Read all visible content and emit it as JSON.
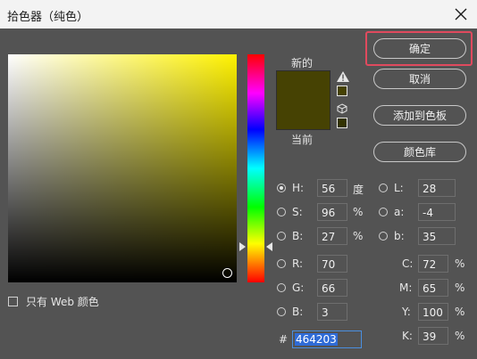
{
  "window": {
    "title": "拾色器（纯色）"
  },
  "preview": {
    "new_label": "新的",
    "current_label": "当前",
    "color": "#464203",
    "gamut_swatch": "#464203",
    "websafe_swatch": "#333300"
  },
  "buttons": {
    "ok": "确定",
    "cancel": "取消",
    "add_swatch": "添加到色板",
    "libraries": "颜色库"
  },
  "hsb": {
    "h_label": "H:",
    "h_value": "56",
    "h_unit": "度",
    "s_label": "S:",
    "s_value": "96",
    "s_unit": "%",
    "b_label": "B:",
    "b_value": "27",
    "b_unit": "%"
  },
  "lab": {
    "l_label": "L:",
    "l_value": "28",
    "a_label": "a:",
    "a_value": "-4",
    "b_label": "b:",
    "b_value": "35"
  },
  "rgb": {
    "r_label": "R:",
    "r_value": "70",
    "g_label": "G:",
    "g_value": "66",
    "b_label": "B:",
    "b_value": "3"
  },
  "cmyk": {
    "c_label": "C:",
    "c_value": "72",
    "c_unit": "%",
    "m_label": "M:",
    "m_value": "65",
    "m_unit": "%",
    "y_label": "Y:",
    "y_value": "100",
    "y_unit": "%",
    "k_label": "K:",
    "k_value": "39",
    "k_unit": "%"
  },
  "hex": {
    "label": "#",
    "value": "464203"
  },
  "web_only": {
    "label": "只有 Web 颜色"
  }
}
